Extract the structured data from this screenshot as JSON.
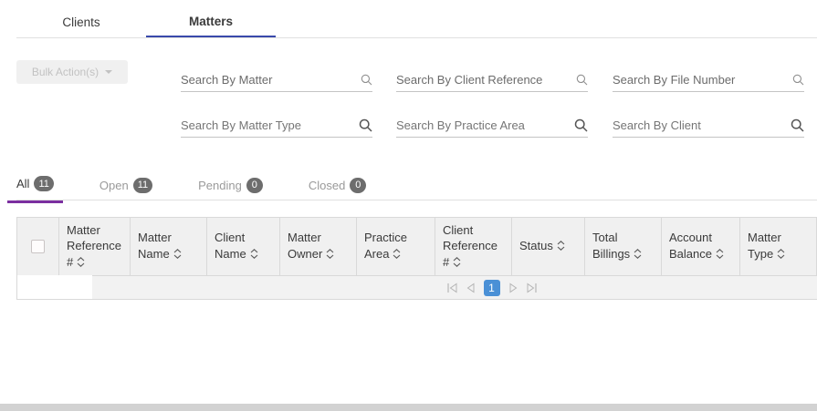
{
  "tabs": {
    "clients": "Clients",
    "matters": "Matters",
    "active": "Matters"
  },
  "toolbar": {
    "bulk_actions": "Bulk Action(s)"
  },
  "search": {
    "fields": [
      {
        "placeholder": "Search By Matter"
      },
      {
        "placeholder": "Search By Client Reference"
      },
      {
        "placeholder": "Search By File Number"
      },
      {
        "placeholder": "Search By Matter Type"
      },
      {
        "placeholder": "Search By Practice Area"
      },
      {
        "placeholder": "Search By Client"
      }
    ]
  },
  "filters": {
    "active": "All",
    "items": [
      {
        "label": "All",
        "count": "11"
      },
      {
        "label": "Open",
        "count": "11"
      },
      {
        "label": "Pending",
        "count": "0"
      },
      {
        "label": "Closed",
        "count": "0"
      }
    ]
  },
  "table": {
    "columns": [
      {
        "label": "Matter Reference #"
      },
      {
        "label": "Matter Name"
      },
      {
        "label": "Client Name"
      },
      {
        "label": "Matter Owner"
      },
      {
        "label": "Practice Area"
      },
      {
        "label": "Client Reference #"
      },
      {
        "label": "Status"
      },
      {
        "label": "Total Billings"
      },
      {
        "label": "Account Balance"
      },
      {
        "label": "Matter Type"
      }
    ],
    "rows": []
  },
  "pagination": {
    "current_page": "1"
  },
  "icons": {
    "search": "magnifier",
    "sort": "up-down-chevrons",
    "caret": "caret-down",
    "first": "skip-to-first",
    "prev": "previous-page",
    "next": "next-page",
    "last": "skip-to-last"
  },
  "colors": {
    "active_tab_underline": "#3949ab",
    "filter_active_underline": "#7b2fa0",
    "badge_bg": "#6d6d6d",
    "header_bg": "#f0f0f0",
    "pagination_active_bg": "#4a90d6"
  }
}
